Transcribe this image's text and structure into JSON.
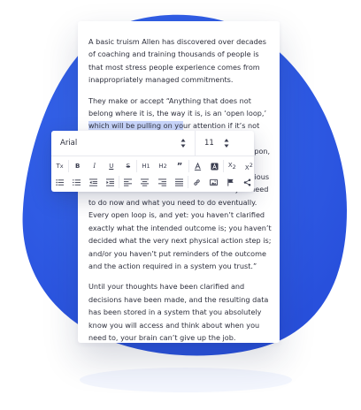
{
  "document": {
    "paragraphs": [
      {
        "text": "A basic truism Allen has discovered over decades of coaching and training thousands of people is that most stress people experience comes from inappropriately managed commitments."
      },
      {
        "before": "They make or accept “Anything that does not belong where it is, the way it is, is an ‘open loop,’ ",
        "highlight": "which will be pulling on yo",
        "after": "ur attention if it’s not complete. Any agreements you’ve made with yourself or others, that have not been acted upon, drain energy. Why are these open loops so draining? Ultimately, it’s because the unconscious mind cannot differentiate between what you need to do now and what you need to do eventually. Every open loop is, and yet: you haven’t clarified exactly what the intended outcome is; you haven’t decided what the very next physical action step is; and/or you haven’t put reminders of the outcome and the action required in a system you trust.”"
      },
      {
        "text": "Until your thoughts have been clarified and decisions have been made, and the resulting data has been stored in a system that you absolutely know you will access and think about when you need to, your brain can’t give up the job."
      }
    ]
  },
  "toolbar": {
    "font_family": "Arial",
    "font_size": "11",
    "row1": {
      "clear_format": "T",
      "bold": "B",
      "italic": "I",
      "underline": "U",
      "strike": "S",
      "heading1": "H",
      "heading2": "H",
      "quote": "”",
      "subscript": "X",
      "superscript": "X"
    }
  },
  "colors": {
    "blob": "#2f5fe8",
    "highlight": "#c9d6fb",
    "text": "#2d2f3c"
  }
}
